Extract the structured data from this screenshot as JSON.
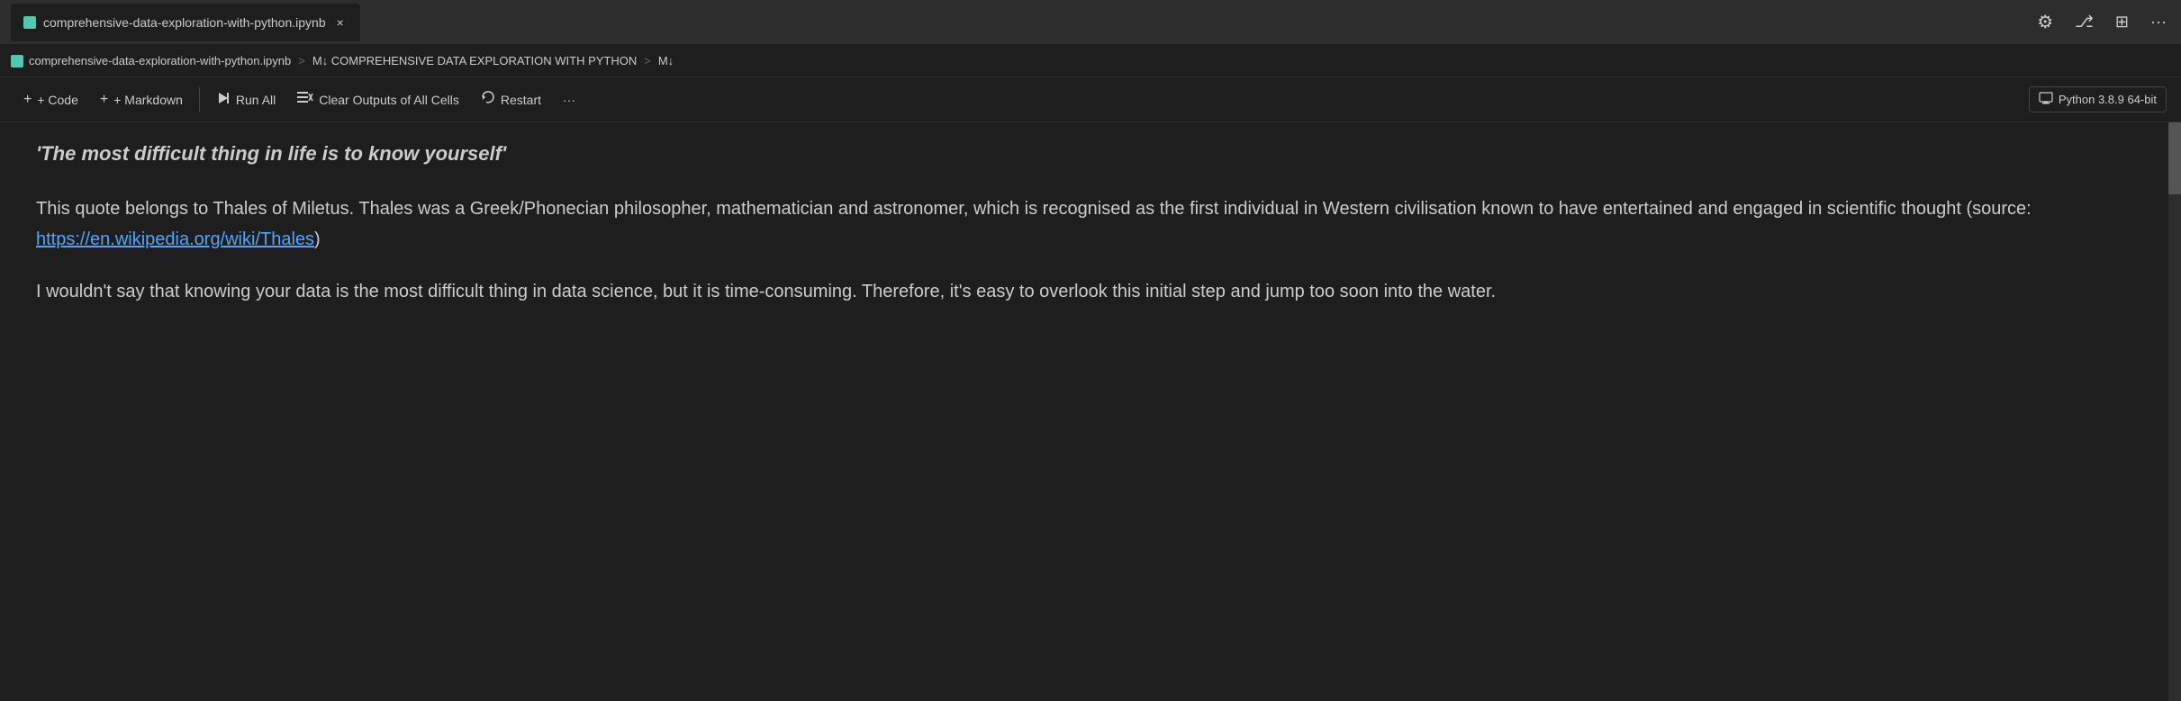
{
  "tab": {
    "icon_color": "#4ec9b0",
    "title": "comprehensive-data-exploration-with-python.ipynb",
    "close_label": "×"
  },
  "tab_right_icons": {
    "gear": "⚙",
    "branch": "⎇",
    "split": "⊞",
    "more": "···"
  },
  "breadcrumb": {
    "icon_color": "#4ec9b0",
    "file": "comprehensive-data-exploration-with-python.ipynb",
    "sep1": ">",
    "section": "M↓ COMPREHENSIVE DATA EXPLORATION WITH PYTHON",
    "sep2": ">",
    "subsection": "M↓"
  },
  "toolbar": {
    "add_code_label": "+ Code",
    "add_markdown_label": "+ Markdown",
    "run_all_label": "Run All",
    "clear_outputs_label": "Clear Outputs of All Cells",
    "restart_label": "Restart",
    "more_label": "···",
    "kernel_icon": "🖥",
    "kernel_label": "Python 3.8.9 64-bit"
  },
  "content": {
    "quote": "'The most difficult thing in life is to know yourself'",
    "paragraph1_prefix": "This quote belongs to Thales of Miletus. Thales was a Greek/Phonecian philosopher, mathematician and astronomer, which is recognised as the first individual in Western civilisation known to have entertained and engaged in scientific thought (source: ",
    "paragraph1_link_text": "https://en.wikipedia.org/wiki/Thales",
    "paragraph1_link_href": "https://en.wikipedia.org/wiki/Thales",
    "paragraph1_suffix": ")",
    "paragraph2": "I wouldn't say that knowing your data is the most difficult thing in data science, but it is time-consuming. Therefore, it's easy to overlook this initial step and jump too soon into the water."
  }
}
